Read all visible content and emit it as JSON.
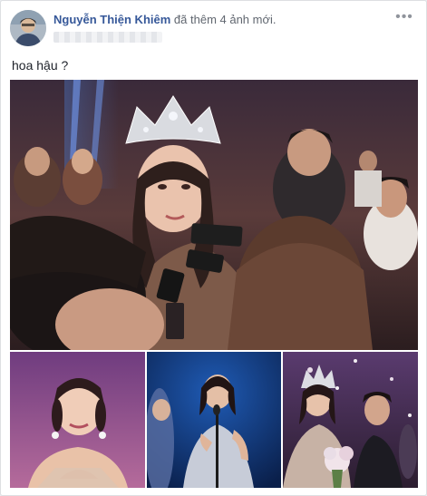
{
  "post": {
    "author_name": "Nguyễn Thiện Khiêm",
    "action_text": "đã thêm 4 ảnh mới.",
    "options_icon": "ellipsis-icon",
    "text": "hoa hậu ?"
  },
  "colors": {
    "author_link": "#365899",
    "meta_text": "#616770",
    "body_text": "#1d2129"
  },
  "photos": [
    {
      "name": "main-photo",
      "description_icon": "photo"
    },
    {
      "name": "photo-2",
      "description_icon": "photo"
    },
    {
      "name": "photo-3",
      "description_icon": "photo"
    },
    {
      "name": "photo-4",
      "description_icon": "photo"
    }
  ]
}
